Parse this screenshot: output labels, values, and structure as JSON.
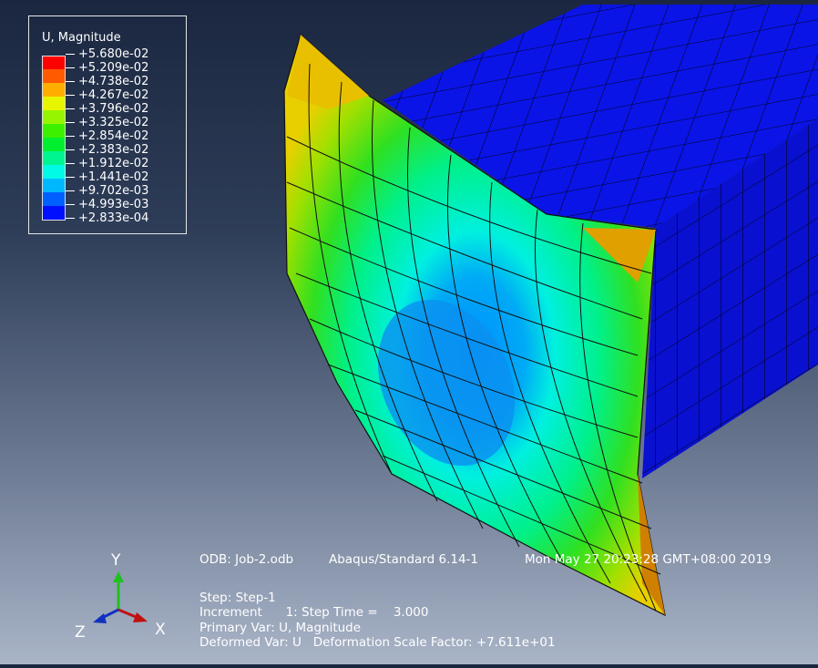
{
  "legend": {
    "title": "U, Magnitude",
    "entries": [
      {
        "value": "+5.680e-02",
        "color": "#ff0000"
      },
      {
        "value": "+5.209e-02",
        "color": "#ff5a00"
      },
      {
        "value": "+4.738e-02",
        "color": "#ffae00"
      },
      {
        "value": "+4.267e-02",
        "color": "#e8f500"
      },
      {
        "value": "+3.796e-02",
        "color": "#96f500"
      },
      {
        "value": "+3.325e-02",
        "color": "#3cf000"
      },
      {
        "value": "+2.854e-02",
        "color": "#00f030"
      },
      {
        "value": "+2.383e-02",
        "color": "#00f590"
      },
      {
        "value": "+1.912e-02",
        "color": "#00fae6"
      },
      {
        "value": "+1.441e-02",
        "color": "#00b8ff"
      },
      {
        "value": "+9.702e-03",
        "color": "#0060ff"
      },
      {
        "value": "+4.993e-03",
        "color": "#0010ff"
      },
      {
        "value": "+2.833e-04",
        "color": ""
      }
    ]
  },
  "info": {
    "odb": "ODB: Job-2.odb",
    "solver": "Abaqus/Standard 6.14-1",
    "date": "Mon May 27 20:23:28 GMT+08:00 2019",
    "step": "Step: Step-1",
    "increment": "Increment      1: Step Time =    3.000",
    "primary_var": "Primary Var: U, Magnitude",
    "deformed_var": "Deformed Var: U   Deformation Scale Factor: +7.611e+01"
  },
  "triad": {
    "x": "X",
    "y": "Y",
    "z": "Z"
  }
}
